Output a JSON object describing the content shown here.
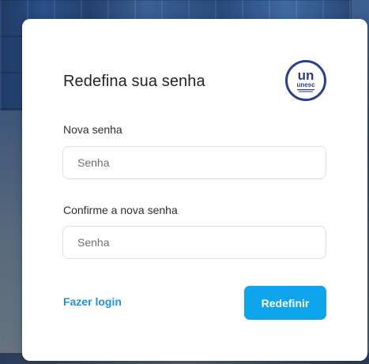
{
  "form": {
    "title": "Redefina sua senha",
    "new_password_label": "Nova senha",
    "new_password_placeholder": "Senha",
    "confirm_password_label": "Confirme a nova senha",
    "confirm_password_placeholder": "Senha",
    "login_link": "Fazer login",
    "submit_label": "Redefinir"
  },
  "logo": {
    "icon": "unesc-logo",
    "text_top": "un",
    "text_bottom": "unesc"
  },
  "colors": {
    "accent": "#0ea5ec",
    "link": "#1d93d8",
    "logo_blue": "#2b3e8c"
  }
}
